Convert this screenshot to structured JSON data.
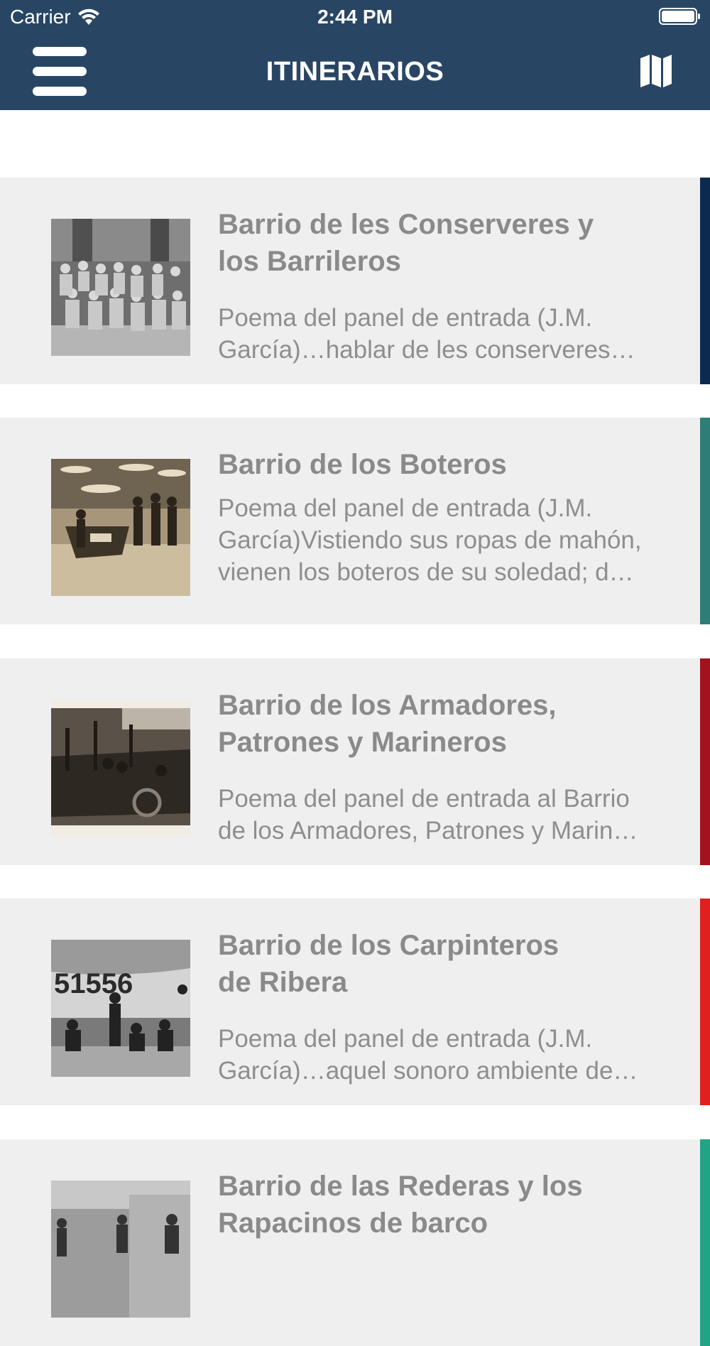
{
  "status_bar": {
    "carrier": "Carrier",
    "time": "2:44 PM"
  },
  "nav": {
    "title": "ITINERARIOS",
    "menu_icon": "hamburger-menu-icon",
    "map_icon": "map-icon",
    "color": "#284664"
  },
  "itineraries": [
    {
      "title_line1": "Barrio de les Conserveres y",
      "title_line2": "los Barrileros",
      "desc_line1": "Poema del panel de entrada (J.M.",
      "desc_line2": "García)…hablar de les conserveres…",
      "desc_line3": "",
      "accent": "#0c2a4f"
    },
    {
      "title_line1": "Barrio de los Boteros",
      "title_line2": "",
      "desc_line1": "Poema del panel de entrada (J.M.",
      "desc_line2": "García)Vistiendo sus ropas de mahón,",
      "desc_line3": "vienen los boteros de su soledad; d…",
      "accent": "#2e7d76"
    },
    {
      "title_line1": "Barrio de los Armadores,",
      "title_line2": "Patrones y Marineros",
      "desc_line1": "Poema del panel de entrada al Barrio",
      "desc_line2": "de los Armadores, Patrones y Marin…",
      "desc_line3": "",
      "accent": "#a3121f"
    },
    {
      "title_line1": "Barrio de los Carpinteros",
      "title_line2": "de Ribera",
      "desc_line1": "Poema del panel de entrada (J.M.",
      "desc_line2": "García)…aquel sonoro ambiente de…",
      "desc_line3": "",
      "accent": "#e01f1f"
    },
    {
      "title_line1": "Barrio de las Rederas y los",
      "title_line2": "Rapacinos de barco",
      "desc_line1": "",
      "desc_line2": "",
      "desc_line3": "",
      "accent": "#21a386"
    }
  ]
}
